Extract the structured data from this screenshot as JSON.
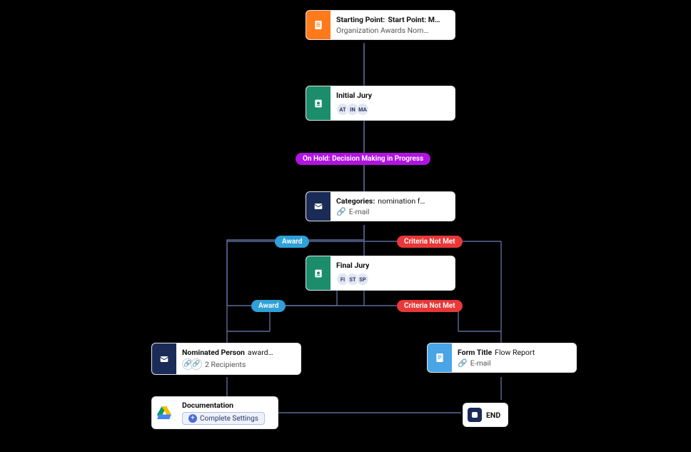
{
  "nodes": {
    "start": {
      "title_label": "Starting Point:",
      "title_value": "Start Point: M…",
      "subtitle": "Organization Awards Nom…"
    },
    "initial_jury": {
      "title": "Initial Jury",
      "avatars": [
        "AT",
        "IN",
        "MA"
      ]
    },
    "hold_pill": "On Hold: Decision Making in Progress",
    "categories": {
      "title_label": "Categories:",
      "title_value": "nomination f…",
      "link_label": "E-mail"
    },
    "award_label_1": "Award",
    "criteria_label_1": "Criteria Not Met",
    "final_jury": {
      "title": "Final Jury",
      "avatars": [
        "FI",
        "ST",
        "SP"
      ]
    },
    "award_label_2": "Award",
    "criteria_label_2": "Criteria Not Met",
    "nominated": {
      "title_label": "Nominated Person",
      "title_value": "award…",
      "recipients": "2 Recipients"
    },
    "form_report": {
      "title_label": "Form Title",
      "title_value": "Flow Report",
      "link_label": "E-mail"
    },
    "documentation": {
      "title": "Documentation",
      "button": "Complete Settings"
    },
    "end": "END"
  },
  "colors": {
    "orange": "#ff7a1a",
    "teal": "#1b8d6b",
    "navy": "#1a2b58",
    "lightblue": "#49a5e6",
    "purple": "#b014e0",
    "red": "#e83838"
  }
}
